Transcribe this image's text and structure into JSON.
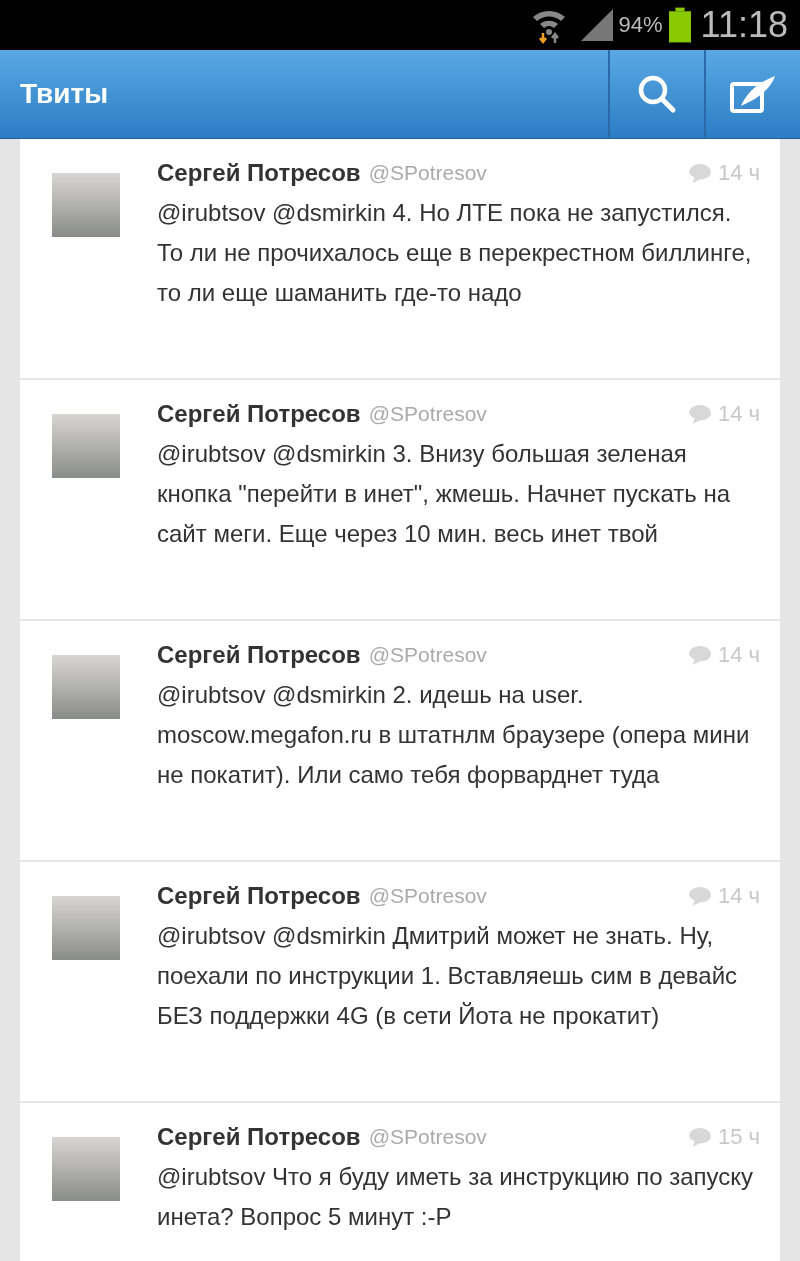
{
  "status_bar": {
    "battery_text": "94%",
    "time": "11:18"
  },
  "action_bar": {
    "title": "Твиты"
  },
  "tweets": [
    {
      "name": "Сергей Потресов",
      "handle": "@SPotresov",
      "time": "14 ч",
      "text": "@irubtsov @dsmirkin 4. Но ЛТЕ пока не запустился. То ли не прочихалось еще в перекрестном биллинге, то ли еще шаманить где-то надо"
    },
    {
      "name": "Сергей Потресов",
      "handle": "@SPotresov",
      "time": "14 ч",
      "text": "@irubtsov @dsmirkin 3. Внизу большая зеленая кнопка \"перейти в инет\", жмешь. Начнет пускать на сайт меги. Еще через 10 мин. весь инет твой"
    },
    {
      "name": "Сергей Потресов",
      "handle": "@SPotresov",
      "time": "14 ч",
      "text": "@irubtsov @dsmirkin 2. идешь на user. moscow.megafon.ru в штатнлм браузере (опера мини не покатит). Или само тебя форварднет туда"
    },
    {
      "name": "Сергей Потресов",
      "handle": "@SPotresov",
      "time": "14 ч",
      "text": "@irubtsov @dsmirkin Дмитрий может не знать. Ну, поехали по инструкции 1. Вставляешь сим в девайс БЕЗ поддержки 4G (в сети Йота не прокатит)"
    },
    {
      "name": "Сергей Потресов",
      "handle": "@SPotresov",
      "time": "15 ч",
      "text": "@irubtsov Что я буду иметь за инструкцию по запуску инета? Вопрос 5 минут :-P"
    }
  ]
}
